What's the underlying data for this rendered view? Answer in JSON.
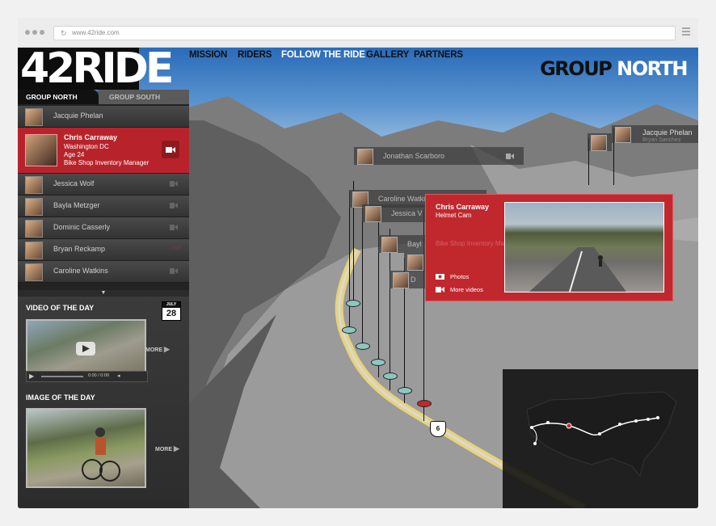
{
  "browser": {
    "url": "www.42ride.com"
  },
  "site": {
    "logo": "42RIDE",
    "nav": [
      "MISSION",
      "RIDERS",
      "FOLLOW THE RIDE",
      "GALLERY",
      "PARTNERS"
    ],
    "active_nav": "FOLLOW THE RIDE",
    "group_title_1": "GROUP",
    "group_title_2": "NORTH"
  },
  "tabs": {
    "north": "GROUP NORTH",
    "south": "GROUP SOUTH"
  },
  "riders": {
    "top": "Jacquie Phelan",
    "selected": {
      "name": "Chris Carraway",
      "location": "Washington DC",
      "age": "Age 24",
      "job": "Bike Shop Inventory Manager"
    },
    "list": [
      "Jessica Wolf",
      "Bayla Metzger",
      "Dominic Casserly",
      "Bryan Reckamp",
      "Caroline Watkins"
    ],
    "status_live": "LIVE",
    "scroll_glyph": "▼"
  },
  "video_of_day": {
    "title": "VIDEO OF THE DAY",
    "month": "JULY",
    "day": "28",
    "time": "0:00 / 0:00",
    "more": "MORE"
  },
  "image_of_day": {
    "title": "IMAGE OF THE DAY",
    "more": "MORE"
  },
  "map_flags": {
    "jacquie": "Jacquie Phelan",
    "hidden": "Bryan Sanchez",
    "jonathan": "Jonathan Scarboro",
    "caroline": "Caroline Watkins",
    "jessica": "Jessica V",
    "bayla": "Bayl",
    "d": "D"
  },
  "route_shield": "6",
  "popup": {
    "name": "Chris Carraway",
    "subtitle": "Helmet Cam",
    "ghost": "Bike Shop Inventory Manager",
    "photos": "Photos",
    "videos": "More videos"
  },
  "colors": {
    "accent_red": "#c0282e",
    "marker": "#8ec6c0"
  }
}
